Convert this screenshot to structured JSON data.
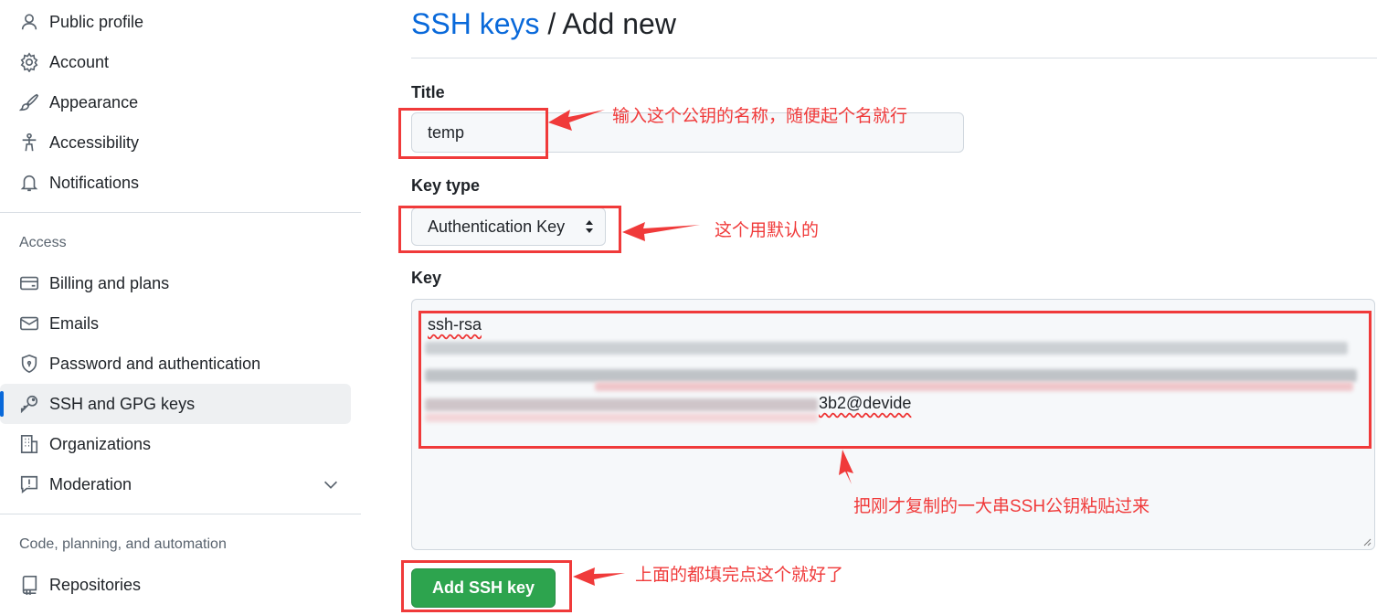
{
  "sidebar": {
    "items": [
      {
        "label": "Public profile",
        "icon": "person-icon"
      },
      {
        "label": "Account",
        "icon": "gear-icon"
      },
      {
        "label": "Appearance",
        "icon": "paintbrush-icon"
      },
      {
        "label": "Accessibility",
        "icon": "accessibility-icon"
      },
      {
        "label": "Notifications",
        "icon": "bell-icon"
      }
    ],
    "access_heading": "Access",
    "access_items": [
      {
        "label": "Billing and plans",
        "icon": "credit-card-icon"
      },
      {
        "label": "Emails",
        "icon": "mail-icon"
      },
      {
        "label": "Password and authentication",
        "icon": "shield-icon"
      },
      {
        "label": "SSH and GPG keys",
        "icon": "key-icon",
        "selected": true
      },
      {
        "label": "Organizations",
        "icon": "organization-icon"
      },
      {
        "label": "Moderation",
        "icon": "report-icon"
      }
    ],
    "code_heading": "Code, planning, and automation",
    "code_items": [
      {
        "label": "Repositories",
        "icon": "repo-icon"
      }
    ]
  },
  "main": {
    "breadcrumb_link": "SSH keys",
    "breadcrumb_sep": "/",
    "breadcrumb_current": "Add new",
    "title_label": "Title",
    "title_value": "temp",
    "key_type_label": "Key type",
    "key_type_value": "Authentication Key",
    "key_label": "Key",
    "key_start": "ssh-rsa",
    "key_end": "3b2@devide",
    "submit_label": "Add SSH key"
  },
  "annotations": {
    "title_note": "输入这个公钥的名称，随便起个名就行",
    "key_type_note": "这个用默认的",
    "key_note": "把刚才复制的一大串SSH公钥粘贴过来",
    "submit_note": "上面的都填完点这个就好了"
  },
  "colors": {
    "accent": "#0969da",
    "button": "#2da44e",
    "annotation": "#f03a3a"
  }
}
